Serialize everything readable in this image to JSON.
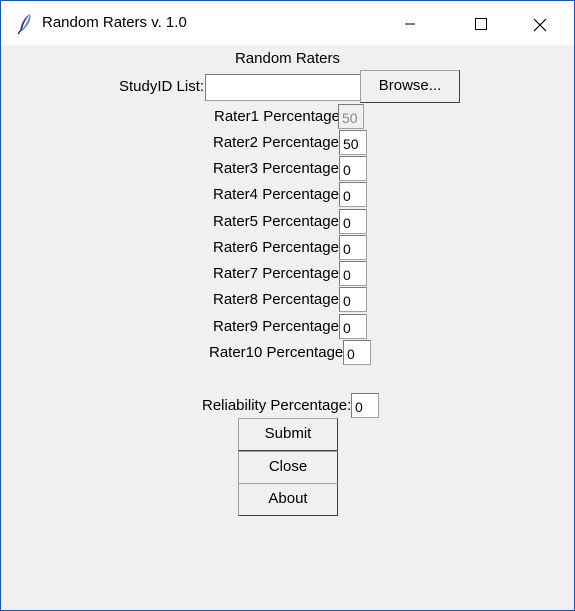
{
  "window": {
    "title": "Random Raters v. 1.0"
  },
  "app": {
    "heading": "Random Raters"
  },
  "studyid": {
    "label": "StudyID List:",
    "value": "",
    "browse_label": "Browse..."
  },
  "raters": [
    {
      "label": "Rater1 Percentage",
      "value": "50",
      "disabled": true
    },
    {
      "label": "Rater2 Percentage:",
      "value": "50"
    },
    {
      "label": "Rater3 Percentage:",
      "value": "0"
    },
    {
      "label": "Rater4 Percentage:",
      "value": "0"
    },
    {
      "label": "Rater5 Percentage:",
      "value": "0"
    },
    {
      "label": "Rater6 Percentage:",
      "value": "0"
    },
    {
      "label": "Rater7 Percentage:",
      "value": "0"
    },
    {
      "label": "Rater8 Percentage:",
      "value": "0"
    },
    {
      "label": "Rater9 Percentage:",
      "value": "0"
    },
    {
      "label": "Rater10 Percentage:",
      "value": "0"
    }
  ],
  "reliability": {
    "label": "Reliability Percentage:",
    "value": "0"
  },
  "buttons": {
    "submit": "Submit",
    "close": "Close",
    "about": "About"
  },
  "colors": {
    "window_border": "#1654b8",
    "client_bg": "#f0f0f0"
  }
}
